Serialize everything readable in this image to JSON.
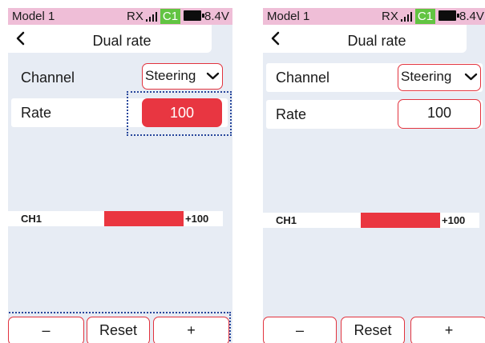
{
  "screens": [
    {
      "status": {
        "model": "Model 1",
        "rx": "RX",
        "channel_badge": "C1",
        "voltage": "8.4V"
      },
      "header": {
        "title": "Dual rate"
      },
      "channel_row": {
        "label": "Channel",
        "value": "Steering"
      },
      "rate_row": {
        "label": "Rate",
        "value": "100"
      },
      "output_bar": {
        "label": "CH1",
        "value": "+100"
      },
      "buttons": {
        "minus": "–",
        "reset": "Reset",
        "plus": "+"
      }
    },
    {
      "status": {
        "model": "Model 1",
        "rx": "RX",
        "channel_badge": "C1",
        "voltage": "8.4V"
      },
      "header": {
        "title": "Dual rate"
      },
      "channel_row": {
        "label": "Channel",
        "value": "Steering"
      },
      "rate_row": {
        "label": "Rate",
        "value": "100"
      },
      "output_bar": {
        "label": "CH1",
        "value": "+100"
      },
      "buttons": {
        "minus": "–",
        "reset": "Reset",
        "plus": "+"
      }
    }
  ],
  "icons": {
    "back": "chevron-left-icon",
    "dropdown": "chevron-down-icon",
    "signal": "signal-bars-icon",
    "battery": "battery-icon"
  },
  "colors": {
    "status_bar": "#efbed7",
    "screen_bg": "#e7ecf4",
    "accent_red": "#e83641",
    "channel_badge": "#62c442",
    "focus_dotted": "#27469b"
  }
}
